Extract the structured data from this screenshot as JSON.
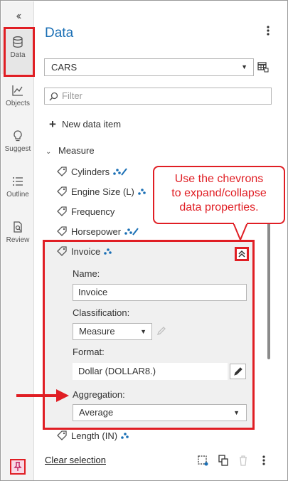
{
  "rail": {
    "collapse_label": "‹‹",
    "items": [
      {
        "label": "Data",
        "icon": "database-icon",
        "active": true
      },
      {
        "label": "Objects",
        "icon": "chart-line-icon"
      },
      {
        "label": "Suggest",
        "icon": "lightbulb-icon"
      },
      {
        "label": "Outline",
        "icon": "list-icon"
      },
      {
        "label": "Review",
        "icon": "review-icon"
      }
    ],
    "pin_icon": "pin-icon"
  },
  "header": {
    "title": "Data",
    "menu_icon": "kebab-icon"
  },
  "source": {
    "selected": "CARS"
  },
  "filter": {
    "placeholder": "Filter"
  },
  "new_item": {
    "label": "New data item"
  },
  "section": {
    "label": "Measure"
  },
  "items": [
    {
      "label": "Cylinders"
    },
    {
      "label": "Engine Size (L)"
    },
    {
      "label": "Frequency"
    },
    {
      "label": "Horsepower"
    },
    {
      "label": "Invoice"
    },
    {
      "label": "Length (IN)"
    }
  ],
  "details": {
    "name_label": "Name:",
    "name_value": "Invoice",
    "classification_label": "Classification:",
    "classification_value": "Measure",
    "format_label": "Format:",
    "format_value": "Dollar (DOLLAR8.)",
    "aggregation_label": "Aggregation:",
    "aggregation_value": "Average"
  },
  "callout": {
    "line1": "Use the chevrons",
    "line2": "to expand/collapse",
    "line3": "data properties."
  },
  "footer": {
    "clear_label": "Clear selection"
  },
  "colors": {
    "accent": "#1a6fb5",
    "annotation": "#e01e24"
  }
}
